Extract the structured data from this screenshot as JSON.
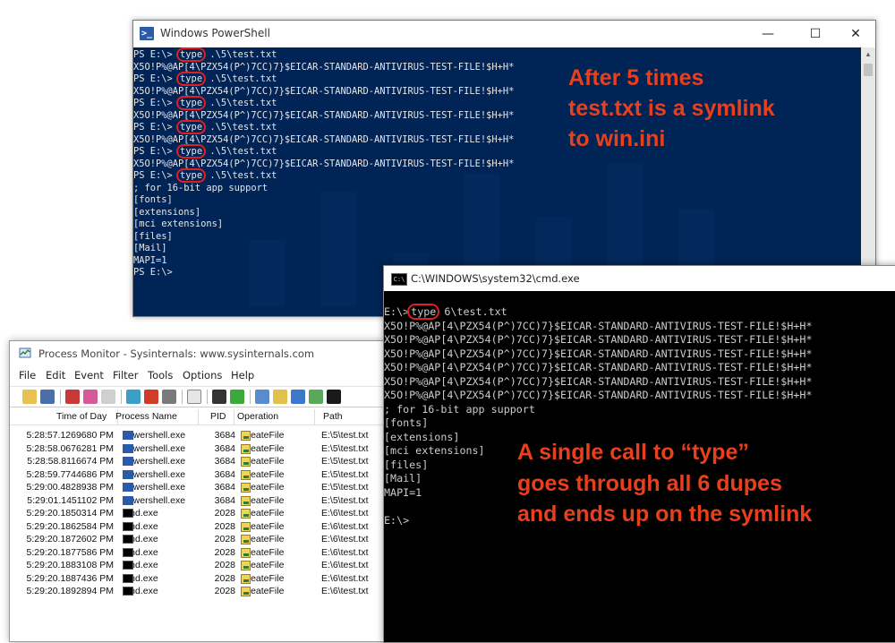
{
  "powershell": {
    "title": "Windows PowerShell",
    "controls": {
      "minimize": "—",
      "maximize": "☐",
      "close": "✕"
    },
    "lines": [
      {
        "pre": "PS E:\\> ",
        "hl": "type",
        "post": " .\\5\\test.txt"
      },
      {
        "pre": "X5O!P%@AP[4\\PZX54(P^)7CC)7}$EICAR-STANDARD-ANTIVIRUS-TEST-FILE!$H+H*",
        "hl": "",
        "post": ""
      },
      {
        "pre": "PS E:\\> ",
        "hl": "type",
        "post": " .\\5\\test.txt"
      },
      {
        "pre": "X5O!P%@AP[4\\PZX54(P^)7CC)7}$EICAR-STANDARD-ANTIVIRUS-TEST-FILE!$H+H*",
        "hl": "",
        "post": ""
      },
      {
        "pre": "PS E:\\> ",
        "hl": "type",
        "post": " .\\5\\test.txt"
      },
      {
        "pre": "X5O!P%@AP[4\\PZX54(P^)7CC)7}$EICAR-STANDARD-ANTIVIRUS-TEST-FILE!$H+H*",
        "hl": "",
        "post": ""
      },
      {
        "pre": "PS E:\\> ",
        "hl": "type",
        "post": " .\\5\\test.txt"
      },
      {
        "pre": "X5O!P%@AP[4\\PZX54(P^)7CC)7}$EICAR-STANDARD-ANTIVIRUS-TEST-FILE!$H+H*",
        "hl": "",
        "post": ""
      },
      {
        "pre": "PS E:\\> ",
        "hl": "type",
        "post": " .\\5\\test.txt"
      },
      {
        "pre": "X5O!P%@AP[4\\PZX54(P^)7CC)7}$EICAR-STANDARD-ANTIVIRUS-TEST-FILE!$H+H*",
        "hl": "",
        "post": ""
      },
      {
        "pre": "PS E:\\> ",
        "hl": "type",
        "post": " .\\5\\test.txt"
      },
      {
        "pre": "; for 16-bit app support",
        "hl": "",
        "post": ""
      },
      {
        "pre": "[fonts]",
        "hl": "",
        "post": ""
      },
      {
        "pre": "[extensions]",
        "hl": "",
        "post": ""
      },
      {
        "pre": "[mci extensions]",
        "hl": "",
        "post": ""
      },
      {
        "pre": "[files]",
        "hl": "",
        "post": ""
      },
      {
        "pre": "[Mail]",
        "hl": "",
        "post": ""
      },
      {
        "pre": "MAPI=1",
        "hl": "",
        "post": ""
      },
      {
        "pre": "PS E:\\>",
        "hl": "",
        "post": ""
      }
    ],
    "annotation": [
      "After 5 times",
      "test.txt is a symlink",
      "to win.ini"
    ]
  },
  "procmon": {
    "title": "Process Monitor - Sysinternals: www.sysinternals.com",
    "menu": [
      "File",
      "Edit",
      "Event",
      "Filter",
      "Tools",
      "Options",
      "Help"
    ],
    "columns": {
      "time": "Time of Day",
      "process": "Process Name",
      "pid": "PID",
      "operation": "Operation",
      "path": "Path"
    },
    "rows": [
      {
        "time": "5:28:57.1269680 PM",
        "proc": "powershell.exe",
        "kind": "ps",
        "pid": "3684",
        "op": "CreateFile",
        "path": "E:\\5\\test.txt"
      },
      {
        "time": "5:28:58.0676281 PM",
        "proc": "powershell.exe",
        "kind": "ps",
        "pid": "3684",
        "op": "CreateFile",
        "path": "E:\\5\\test.txt"
      },
      {
        "time": "5:28:58.8116674 PM",
        "proc": "powershell.exe",
        "kind": "ps",
        "pid": "3684",
        "op": "CreateFile",
        "path": "E:\\5\\test.txt"
      },
      {
        "time": "5:28:59.7744686 PM",
        "proc": "powershell.exe",
        "kind": "ps",
        "pid": "3684",
        "op": "CreateFile",
        "path": "E:\\5\\test.txt"
      },
      {
        "time": "5:29:00.4828938 PM",
        "proc": "powershell.exe",
        "kind": "ps",
        "pid": "3684",
        "op": "CreateFile",
        "path": "E:\\5\\test.txt"
      },
      {
        "time": "5:29:01.1451102 PM",
        "proc": "powershell.exe",
        "kind": "ps",
        "pid": "3684",
        "op": "CreateFile",
        "path": "E:\\5\\test.txt"
      },
      {
        "time": "5:29:20.1850314 PM",
        "proc": "cmd.exe",
        "kind": "cmd",
        "pid": "2028",
        "op": "CreateFile",
        "path": "E:\\6\\test.txt"
      },
      {
        "time": "5:29:20.1862584 PM",
        "proc": "cmd.exe",
        "kind": "cmd",
        "pid": "2028",
        "op": "CreateFile",
        "path": "E:\\6\\test.txt"
      },
      {
        "time": "5:29:20.1872602 PM",
        "proc": "cmd.exe",
        "kind": "cmd",
        "pid": "2028",
        "op": "CreateFile",
        "path": "E:\\6\\test.txt"
      },
      {
        "time": "5:29:20.1877586 PM",
        "proc": "cmd.exe",
        "kind": "cmd",
        "pid": "2028",
        "op": "CreateFile",
        "path": "E:\\6\\test.txt"
      },
      {
        "time": "5:29:20.1883108 PM",
        "proc": "cmd.exe",
        "kind": "cmd",
        "pid": "2028",
        "op": "CreateFile",
        "path": "E:\\6\\test.txt"
      },
      {
        "time": "5:29:20.1887436 PM",
        "proc": "cmd.exe",
        "kind": "cmd",
        "pid": "2028",
        "op": "CreateFile",
        "path": "E:\\6\\test.txt"
      },
      {
        "time": "5:29:20.1892894 PM",
        "proc": "cmd.exe",
        "kind": "cmd",
        "pid": "2028",
        "op": "CreateFile",
        "path": "E:\\6\\test.txt"
      }
    ]
  },
  "cmd": {
    "title": "C:\\WINDOWS\\system32\\cmd.exe",
    "lines": [
      {
        "pre": "E:\\>",
        "hl": "type",
        "post": " 6\\test.txt"
      },
      {
        "pre": "X5O!P%@AP[4\\PZX54(P^)7CC)7}$EICAR-STANDARD-ANTIVIRUS-TEST-FILE!$H+H*",
        "hl": "",
        "post": ""
      },
      {
        "pre": "X5O!P%@AP[4\\PZX54(P^)7CC)7}$EICAR-STANDARD-ANTIVIRUS-TEST-FILE!$H+H*",
        "hl": "",
        "post": ""
      },
      {
        "pre": "X5O!P%@AP[4\\PZX54(P^)7CC)7}$EICAR-STANDARD-ANTIVIRUS-TEST-FILE!$H+H*",
        "hl": "",
        "post": ""
      },
      {
        "pre": "X5O!P%@AP[4\\PZX54(P^)7CC)7}$EICAR-STANDARD-ANTIVIRUS-TEST-FILE!$H+H*",
        "hl": "",
        "post": ""
      },
      {
        "pre": "X5O!P%@AP[4\\PZX54(P^)7CC)7}$EICAR-STANDARD-ANTIVIRUS-TEST-FILE!$H+H*",
        "hl": "",
        "post": ""
      },
      {
        "pre": "X5O!P%@AP[4\\PZX54(P^)7CC)7}$EICAR-STANDARD-ANTIVIRUS-TEST-FILE!$H+H*",
        "hl": "",
        "post": ""
      },
      {
        "pre": "; for 16-bit app support",
        "hl": "",
        "post": ""
      },
      {
        "pre": "[fonts]",
        "hl": "",
        "post": ""
      },
      {
        "pre": "[extensions]",
        "hl": "",
        "post": ""
      },
      {
        "pre": "[mci extensions]",
        "hl": "",
        "post": ""
      },
      {
        "pre": "[files]",
        "hl": "",
        "post": ""
      },
      {
        "pre": "[Mail]",
        "hl": "",
        "post": ""
      },
      {
        "pre": "MAPI=1",
        "hl": "",
        "post": ""
      },
      {
        "pre": "",
        "hl": "",
        "post": ""
      },
      {
        "pre": "E:\\>",
        "hl": "",
        "post": ""
      }
    ],
    "annotation": [
      "A single call to “type”",
      "goes through all 6 dupes",
      "and ends up on the symlink"
    ]
  },
  "colors": {
    "ps_bg": "#012456",
    "annotation": "#e8401d",
    "highlight": "#e02020"
  }
}
